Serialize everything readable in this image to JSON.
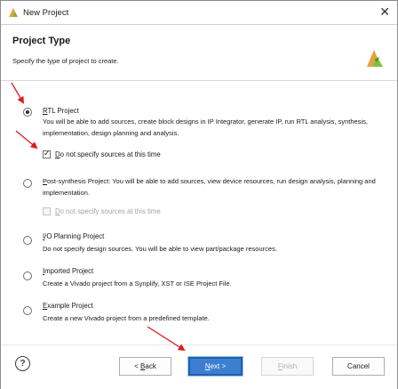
{
  "window": {
    "title": "New Project",
    "close_icon": "close-icon"
  },
  "header": {
    "title": "Project Type",
    "subtitle": "Specify the type of project to create.",
    "logo_icon": "vivado-logo-icon"
  },
  "options": [
    {
      "label_mnemonic": "R",
      "label_rest": "TL Project",
      "description": "You will be able to add sources, create block designs in IP Integrator, generate IP, run RTL analysis, synthesis, implementation, design planning and analysis.",
      "selected": true,
      "checkbox": {
        "mnemonic": "D",
        "rest": "o not specify sources at this time",
        "checked": true,
        "enabled": true
      }
    },
    {
      "label_mnemonic": "P",
      "label_rest": "ost-synthesis Project: You will be able to add sources, view device resources, run design analysis, planning and implementation.",
      "selected": false,
      "checkbox": {
        "mnemonic": "D",
        "rest": "o not specify sources at this time",
        "checked": false,
        "enabled": false
      }
    },
    {
      "label_mnemonic": "I",
      "label_rest": "/O Planning Project",
      "description": "Do not specify design sources. You will be able to view part/package resources.",
      "selected": false
    },
    {
      "label_mnemonic": "I",
      "label_rest": "mported Project",
      "description": "Create a Vivado project from a Synplify, XST or ISE Project File.",
      "selected": false
    },
    {
      "label_mnemonic": "E",
      "label_rest": "xample Project",
      "description": "Create a new Vivado project from a predefined template.",
      "selected": false
    }
  ],
  "footer": {
    "help_label": "?",
    "back_prefix": "< ",
    "back_mnemonic": "B",
    "back_rest": "ack",
    "next_mnemonic": "N",
    "next_rest": "ext >",
    "finish_mnemonic": "F",
    "finish_rest": "inish",
    "cancel_label": "Cancel"
  },
  "colors": {
    "accent": "#3c7fd1",
    "annotation_arrow": "#e01b1b",
    "disabled_text": "#a5a5a5"
  }
}
